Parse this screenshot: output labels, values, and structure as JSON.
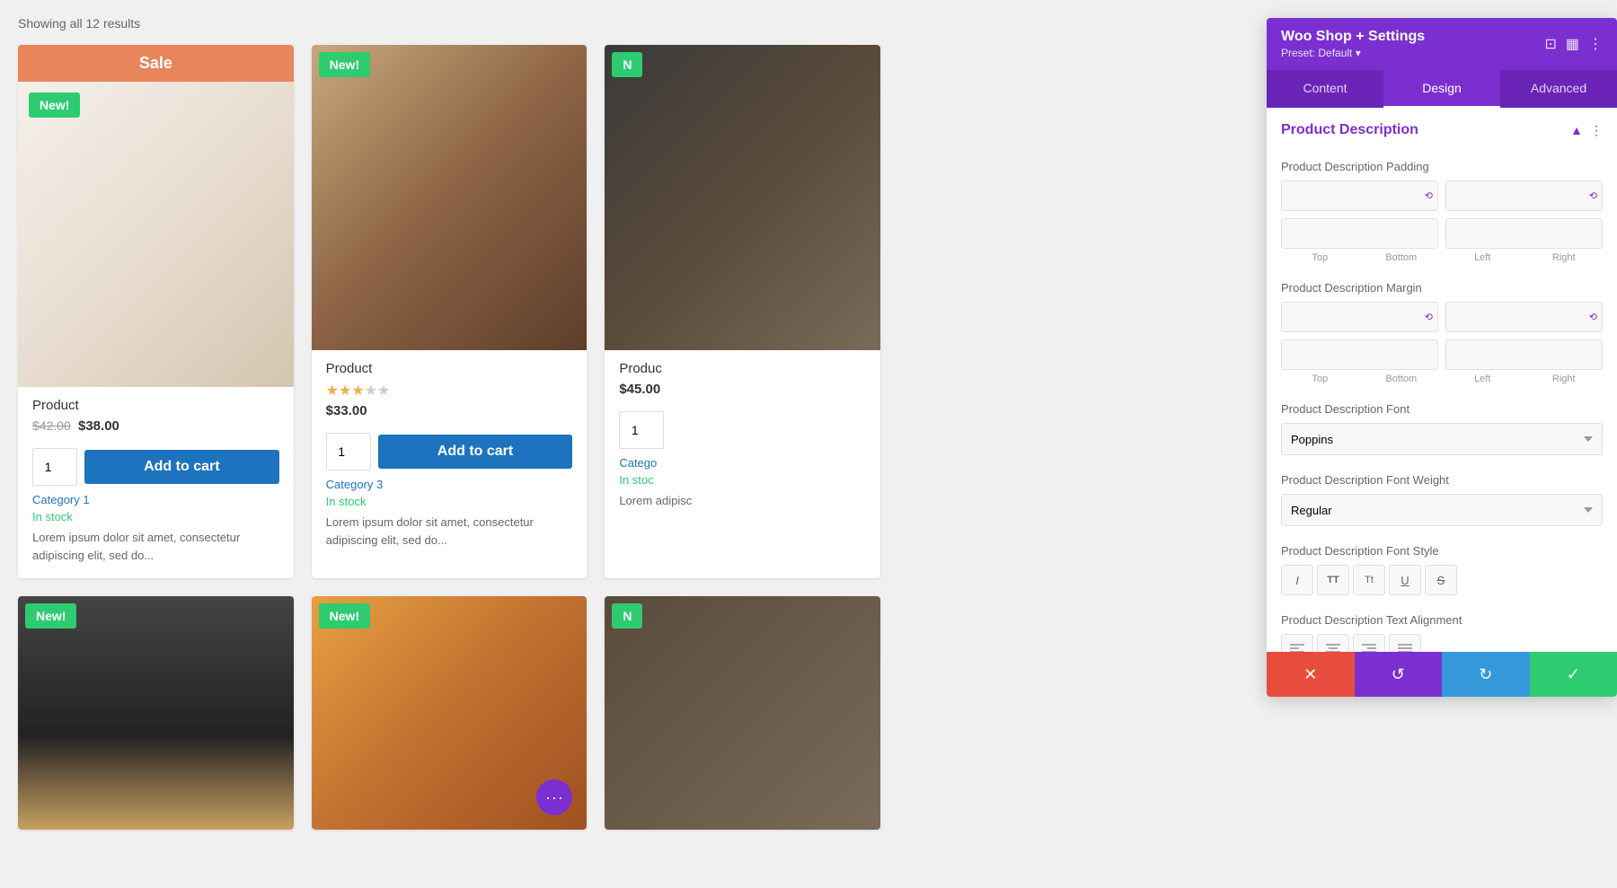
{
  "shop": {
    "showing_results": "Showing all 12 results",
    "products": [
      {
        "id": "product-1",
        "has_sale": true,
        "sale_label": "Sale",
        "badge": "New!",
        "name": "Product",
        "price_old": "$42.00",
        "price_new": "$38.00",
        "quantity": "1",
        "add_to_cart": "Add to cart",
        "category": "Category 1",
        "stock": "In stock",
        "description": "Lorem ipsum dolor sit amet, consectetur adipiscing elit, sed do..."
      },
      {
        "id": "product-2",
        "has_sale": false,
        "badge": "New!",
        "name": "Product",
        "price": "$33.00",
        "stars": 3,
        "total_stars": 5,
        "quantity": "1",
        "add_to_cart": "Add to cart",
        "category": "Category 3",
        "stock": "In stock",
        "description": "Lorem ipsum dolor sit amet, consectetur adipiscing elit, sed do..."
      },
      {
        "id": "product-3",
        "has_sale": false,
        "badge": "N",
        "name": "Produc",
        "price": "$45.00",
        "quantity": "1",
        "category": "Catego",
        "stock": "In stoc",
        "description": "Lorem\nadipisc"
      }
    ],
    "bottom_products": [
      {
        "id": "bottom-1",
        "badge": "New!",
        "has_dots": false
      },
      {
        "id": "bottom-2",
        "badge": "New!",
        "has_dots": true,
        "dots": "···"
      },
      {
        "id": "bottom-3",
        "badge": "N",
        "has_dots": false
      }
    ]
  },
  "panel": {
    "title": "Woo Shop + Settings",
    "preset_label": "Preset: Default ▾",
    "tabs": [
      {
        "id": "content",
        "label": "Content"
      },
      {
        "id": "design",
        "label": "Design",
        "active": true
      },
      {
        "id": "advanced",
        "label": "Advanced"
      }
    ],
    "section": {
      "title": "Product Description"
    },
    "fields": {
      "padding_label": "Product Description Padding",
      "padding_top": "",
      "padding_bottom": "",
      "padding_left": "",
      "padding_right": "",
      "top_label": "Top",
      "bottom_label": "Bottom",
      "left_label": "Left",
      "right_label": "Right",
      "margin_label": "Product Description Margin",
      "margin_top": "",
      "margin_bottom": "",
      "margin_left": "",
      "margin_right": "",
      "font_label": "Product Description Font",
      "font_value": "Poppins",
      "font_weight_label": "Product Description Font Weight",
      "font_weight_value": "Regular",
      "font_style_label": "Product Description Font Style",
      "font_styles": [
        "I",
        "TT",
        "Tt",
        "U",
        "S"
      ],
      "text_align_label": "Product Description Text Alignment",
      "text_aligns": [
        "≡",
        "≡",
        "≡",
        "≡"
      ]
    },
    "actions": {
      "cancel": "✕",
      "undo": "↺",
      "redo": "↻",
      "save": "✓"
    }
  }
}
